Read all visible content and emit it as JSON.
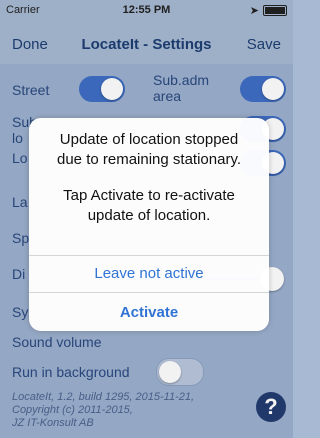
{
  "status_bar": {
    "carrier": "Carrier",
    "time": "12:55 PM",
    "signal_icon": "wifi-icon"
  },
  "nav": {
    "left": "Done",
    "title": "LocateIt - Settings",
    "right": "Save"
  },
  "settings": {
    "street": "Street",
    "sub_adm_area": "Sub.adm\narea",
    "sub_partial_1": "Sub",
    "sub_partial_2": "lo",
    "lo_partial": "Lo",
    "la_partial": "La",
    "sp_partial": "Sp",
    "di_partial": "Di",
    "sy_partial": "Sy",
    "sound_volume": "Sound volume",
    "run_in_background": "Run in background"
  },
  "footer": {
    "line1": "LocateIt, 1.2, build 1295, 2015-11-21,",
    "line2": "Copyright (c) 2011-2015,",
    "line3": "JZ IT-Konsult AB"
  },
  "help_icon": "question-icon",
  "alert": {
    "line1": "Update of location stopped",
    "line2": "due to remaining stationary.",
    "line3": "Tap Activate to re-activate",
    "line4": "update of location.",
    "leave_not_active": "Leave not active",
    "activate": "Activate"
  },
  "colors": {
    "accent": "#3f6ec4",
    "background": "#9cb0cf",
    "alert_button": "#2f73d3"
  }
}
